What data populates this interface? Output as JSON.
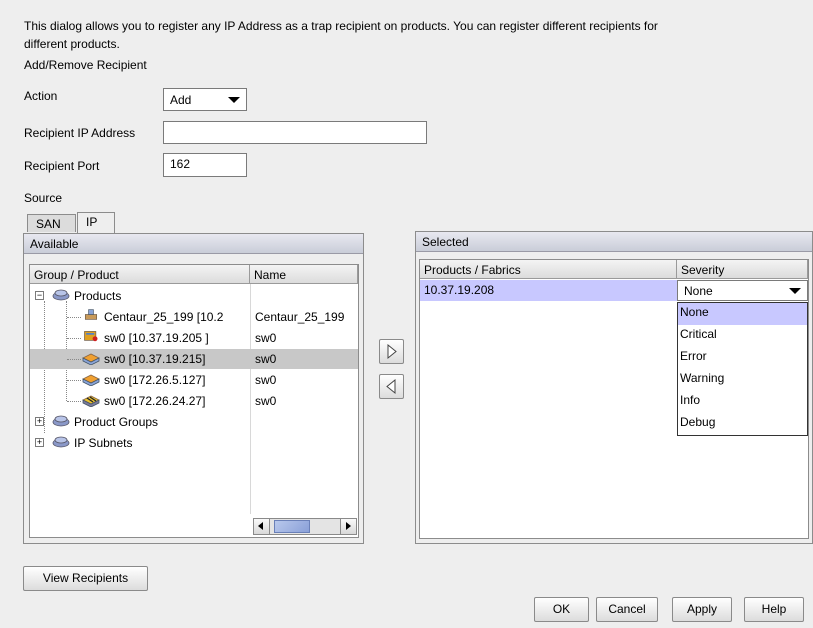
{
  "intro": {
    "line1": "This dialog allows you to register any IP Address as a trap recipient on products. You can register different recipients for",
    "line2": "different products."
  },
  "section_add_remove": "Add/Remove Recipient",
  "action": {
    "label": "Action",
    "value": "Add"
  },
  "recipient_ip": {
    "label": "Recipient IP Address",
    "value": ""
  },
  "recipient_port": {
    "label": "Recipient Port",
    "value": "162"
  },
  "source_label": "Source",
  "tabs": [
    {
      "label": "SAN"
    },
    {
      "label": "IP"
    }
  ],
  "available": {
    "title": "Available",
    "columns": [
      "Group / Product",
      "Name"
    ],
    "rows": [
      {
        "label": "Products",
        "name": "",
        "expander": "−",
        "icon": "products-icon"
      },
      {
        "label": "Centaur_25_199 [10.2",
        "name": "Centaur_25_199",
        "icon": "router-icon"
      },
      {
        "label": "sw0 [10.37.19.205 ]",
        "name": "sw0",
        "icon": "switch-warning-icon"
      },
      {
        "label": "sw0 [10.37.19.215]",
        "name": "sw0",
        "icon": "switch-icon"
      },
      {
        "label": "sw0 [172.26.5.127]",
        "name": "sw0",
        "icon": "switch-icon"
      },
      {
        "label": "sw0 [172.26.24.27]",
        "name": "sw0",
        "icon": "switch-striped-icon"
      },
      {
        "label": "Product Groups",
        "name": "",
        "expander": "+",
        "icon": "product-groups-icon"
      },
      {
        "label": "IP Subnets",
        "name": "",
        "expander": "+",
        "icon": "ip-subnets-icon"
      }
    ]
  },
  "selected": {
    "title": "Selected",
    "columns": [
      "Products / Fabrics",
      "Severity"
    ],
    "rows": [
      {
        "product": "10.37.19.208",
        "severity": "None"
      }
    ],
    "severity_options": [
      "None",
      "Critical",
      "Error",
      "Warning",
      "Info",
      "Debug"
    ]
  },
  "buttons": {
    "view_recipients": "View Recipients",
    "ok": "OK",
    "cancel": "Cancel",
    "apply": "Apply",
    "help": "Help"
  },
  "colors": {
    "selected_row": "#c8c8ff",
    "highlight_row": "#c8c8c8"
  }
}
